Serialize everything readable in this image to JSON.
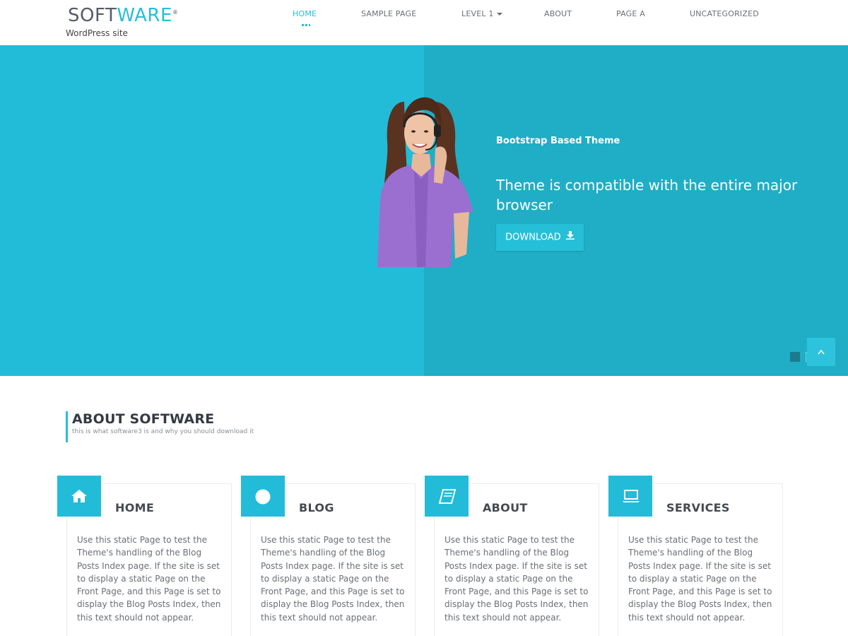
{
  "site": {
    "logo_part1": "SOFT",
    "logo_part2": "WARE",
    "logo_mark": "®",
    "tagline": "WordPress site"
  },
  "nav": {
    "items": [
      {
        "label": "HOME",
        "active": true
      },
      {
        "label": "SAMPLE PAGE"
      },
      {
        "label": "LEVEL 1",
        "has_dropdown": true
      },
      {
        "label": "ABOUT"
      },
      {
        "label": "PAGE A"
      },
      {
        "label": "UNCATEGORIZED"
      }
    ]
  },
  "hero": {
    "subtitle": "Bootstrap Based Theme",
    "title": "Theme is compatible with the entire major browser",
    "button_label": "DOWNLOAD",
    "button_icon": "download-icon",
    "scroll_top_icon": "chevron-up-icon"
  },
  "about": {
    "title": "ABOUT SOFTWARE",
    "subtitle": "this is what software3 is and why you should download it"
  },
  "cards": [
    {
      "title": "HOME",
      "icon": "home-icon",
      "text": "Use this static Page to test the Theme's handling of the Blog Posts Index page. If the site is set to display a static Page on the Front Page, and this Page is set to display the Blog Posts Index, then this text should not appear."
    },
    {
      "title": "BLOG",
      "icon": "circle-icon",
      "text": "Use this static Page to test the Theme's handling of the Blog Posts Index page. If the site is set to display a static Page on the Front Page, and this Page is set to display the Blog Posts Index, then this text should not appear."
    },
    {
      "title": "ABOUT",
      "icon": "book-icon",
      "text": "Use this static Page to test the Theme's handling of the Blog Posts Index page. If the site is set to display a static Page on the Front Page, and this Page is set to display the Blog Posts Index, then this text should not appear."
    },
    {
      "title": "SERVICES",
      "icon": "laptop-icon",
      "text": "Use this static Page to test the Theme's handling of the Blog Posts Index page. If the site is set to display a static Page on the Front Page, and this Page is set to display the Blog Posts Index, then this text should not appear."
    }
  ],
  "colors": {
    "accent": "#25bfd8",
    "hero_left": "#22bcd8",
    "hero_right": "#1faec6"
  }
}
